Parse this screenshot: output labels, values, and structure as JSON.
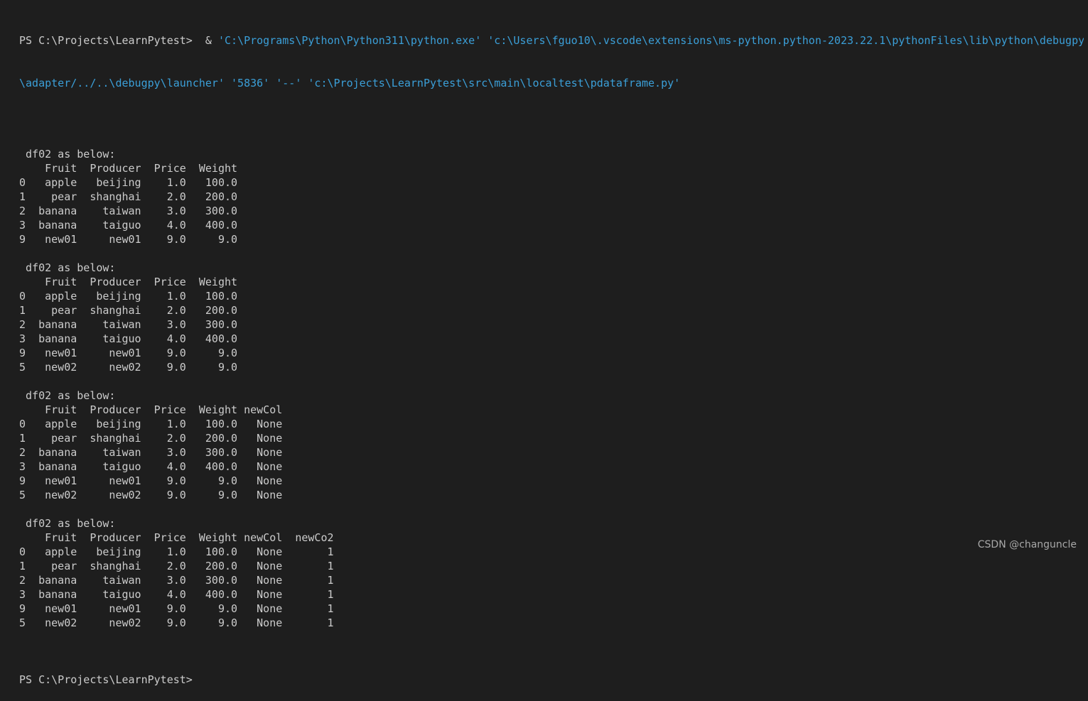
{
  "terminal": {
    "prompt_1": "PS C:\\Projects\\LearnPytest> ",
    "amp": " & ",
    "arg_python": "'C:\\Programs\\Python\\Python311\\python.exe'",
    "arg_launcher": "'c:\\Users\\fguo10\\.vscode\\extensions\\ms-python.python-2023.22.1\\pythonFiles\\lib\\python\\debugpy",
    "arg_launcher_cont": "\\adapter/../..\\debugpy\\launcher'",
    "arg_port": "'5836'",
    "arg_sep": "'--'",
    "arg_script": "'c:\\Projects\\LearnPytest\\src\\main\\localtest\\pdataframe.py'",
    "blocks": [
      {
        "title": " df02 as below:",
        "lines": [
          "    Fruit  Producer  Price  Weight",
          "0   apple   beijing    1.0   100.0",
          "1    pear  shanghai    2.0   200.0",
          "2  banana    taiwan    3.0   300.0",
          "3  banana    taiguo    4.0   400.0",
          "9   new01     new01    9.0     9.0"
        ]
      },
      {
        "title": " df02 as below:",
        "lines": [
          "    Fruit  Producer  Price  Weight",
          "0   apple   beijing    1.0   100.0",
          "1    pear  shanghai    2.0   200.0",
          "2  banana    taiwan    3.0   300.0",
          "3  banana    taiguo    4.0   400.0",
          "9   new01     new01    9.0     9.0",
          "5   new02     new02    9.0     9.0"
        ]
      },
      {
        "title": " df02 as below:",
        "lines": [
          "    Fruit  Producer  Price  Weight newCol",
          "0   apple   beijing    1.0   100.0   None",
          "1    pear  shanghai    2.0   200.0   None",
          "2  banana    taiwan    3.0   300.0   None",
          "3  banana    taiguo    4.0   400.0   None",
          "9   new01     new01    9.0     9.0   None",
          "5   new02     new02    9.0     9.0   None"
        ]
      },
      {
        "title": " df02 as below:",
        "lines": [
          "    Fruit  Producer  Price  Weight newCol  newCo2",
          "0   apple   beijing    1.0   100.0   None       1",
          "1    pear  shanghai    2.0   200.0   None       1",
          "2  banana    taiwan    3.0   300.0   None       1",
          "3  banana    taiguo    4.0   400.0   None       1",
          "9   new01     new01    9.0     9.0   None       1",
          "5   new02     new02    9.0     9.0   None       1"
        ]
      }
    ],
    "prompt_final": "PS C:\\Projects\\LearnPytest>"
  },
  "watermark": "CSDN @changuncle",
  "colors": {
    "background": "#1e1e1e",
    "text": "#cccccc",
    "string": "#3b9fd8"
  }
}
